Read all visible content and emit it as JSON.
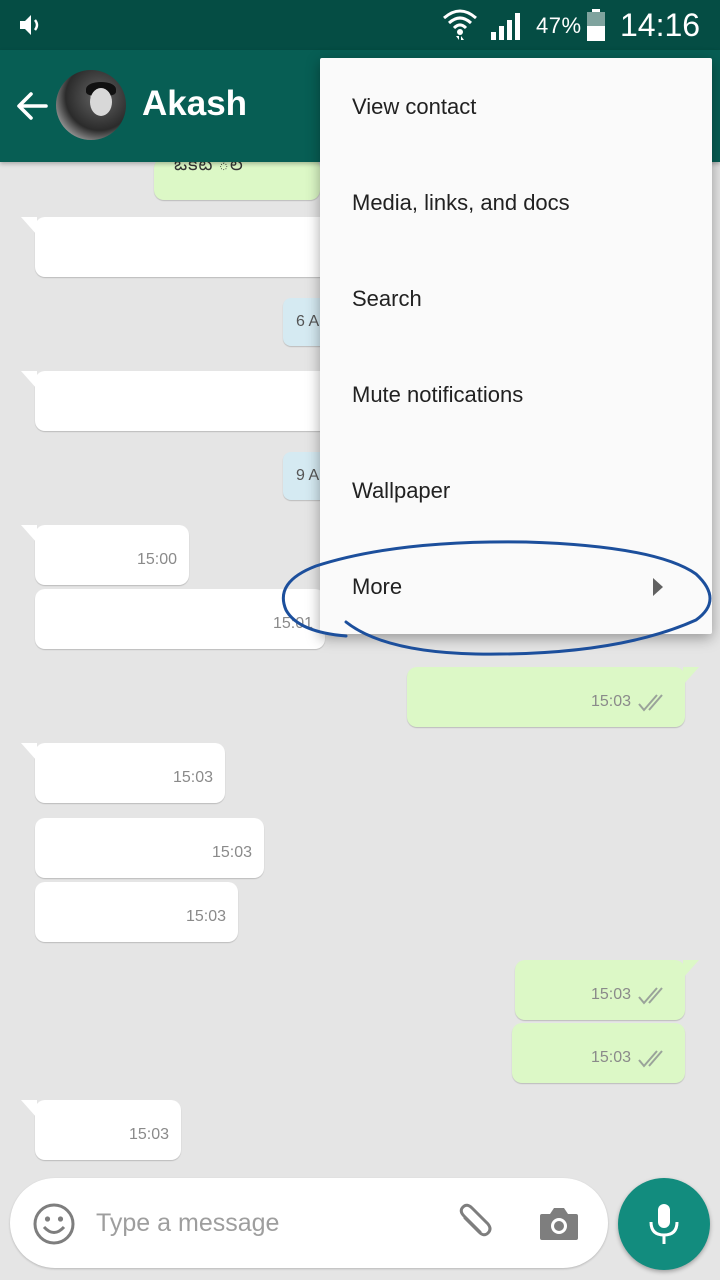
{
  "status_bar": {
    "battery_percent": "47%",
    "time": "14:16",
    "icons": [
      "volume-icon",
      "wifi-icon",
      "signal-icon",
      "battery-icon"
    ]
  },
  "header": {
    "contact_name": "Akash",
    "back_icon": "arrow-left-icon"
  },
  "chat": {
    "partial_text": "ఒకటి ిల",
    "date_chips": [
      "6 A",
      "9 A"
    ],
    "messages": [
      {
        "direction": "in",
        "time": "15:00"
      },
      {
        "direction": "in",
        "time": "15:01"
      },
      {
        "direction": "out",
        "time": "15:03",
        "status": "read"
      },
      {
        "direction": "in",
        "time": "15:03"
      },
      {
        "direction": "in",
        "time": "15:03"
      },
      {
        "direction": "in",
        "time": "15:03"
      },
      {
        "direction": "out",
        "time": "15:03",
        "status": "read"
      },
      {
        "direction": "out",
        "time": "15:03",
        "status": "read"
      },
      {
        "direction": "in",
        "time": "15:03"
      }
    ]
  },
  "menu": {
    "items": [
      {
        "label": "View contact"
      },
      {
        "label": "Media, links, and docs"
      },
      {
        "label": "Search"
      },
      {
        "label": "Mute notifications"
      },
      {
        "label": "Wallpaper"
      },
      {
        "label": "More",
        "has_submenu": true
      }
    ],
    "highlighted_item": "More"
  },
  "input": {
    "placeholder": "Type a message",
    "icons": [
      "emoji-icon",
      "paperclip-icon",
      "camera-icon",
      "mic-icon"
    ]
  },
  "colors": {
    "status_bar": "#054d44",
    "app_bar": "#075e54",
    "incoming_bubble": "#ffffff",
    "outgoing_bubble": "#dcf8c6",
    "fab": "#128c7e",
    "annotation": "#1c4f9c"
  }
}
